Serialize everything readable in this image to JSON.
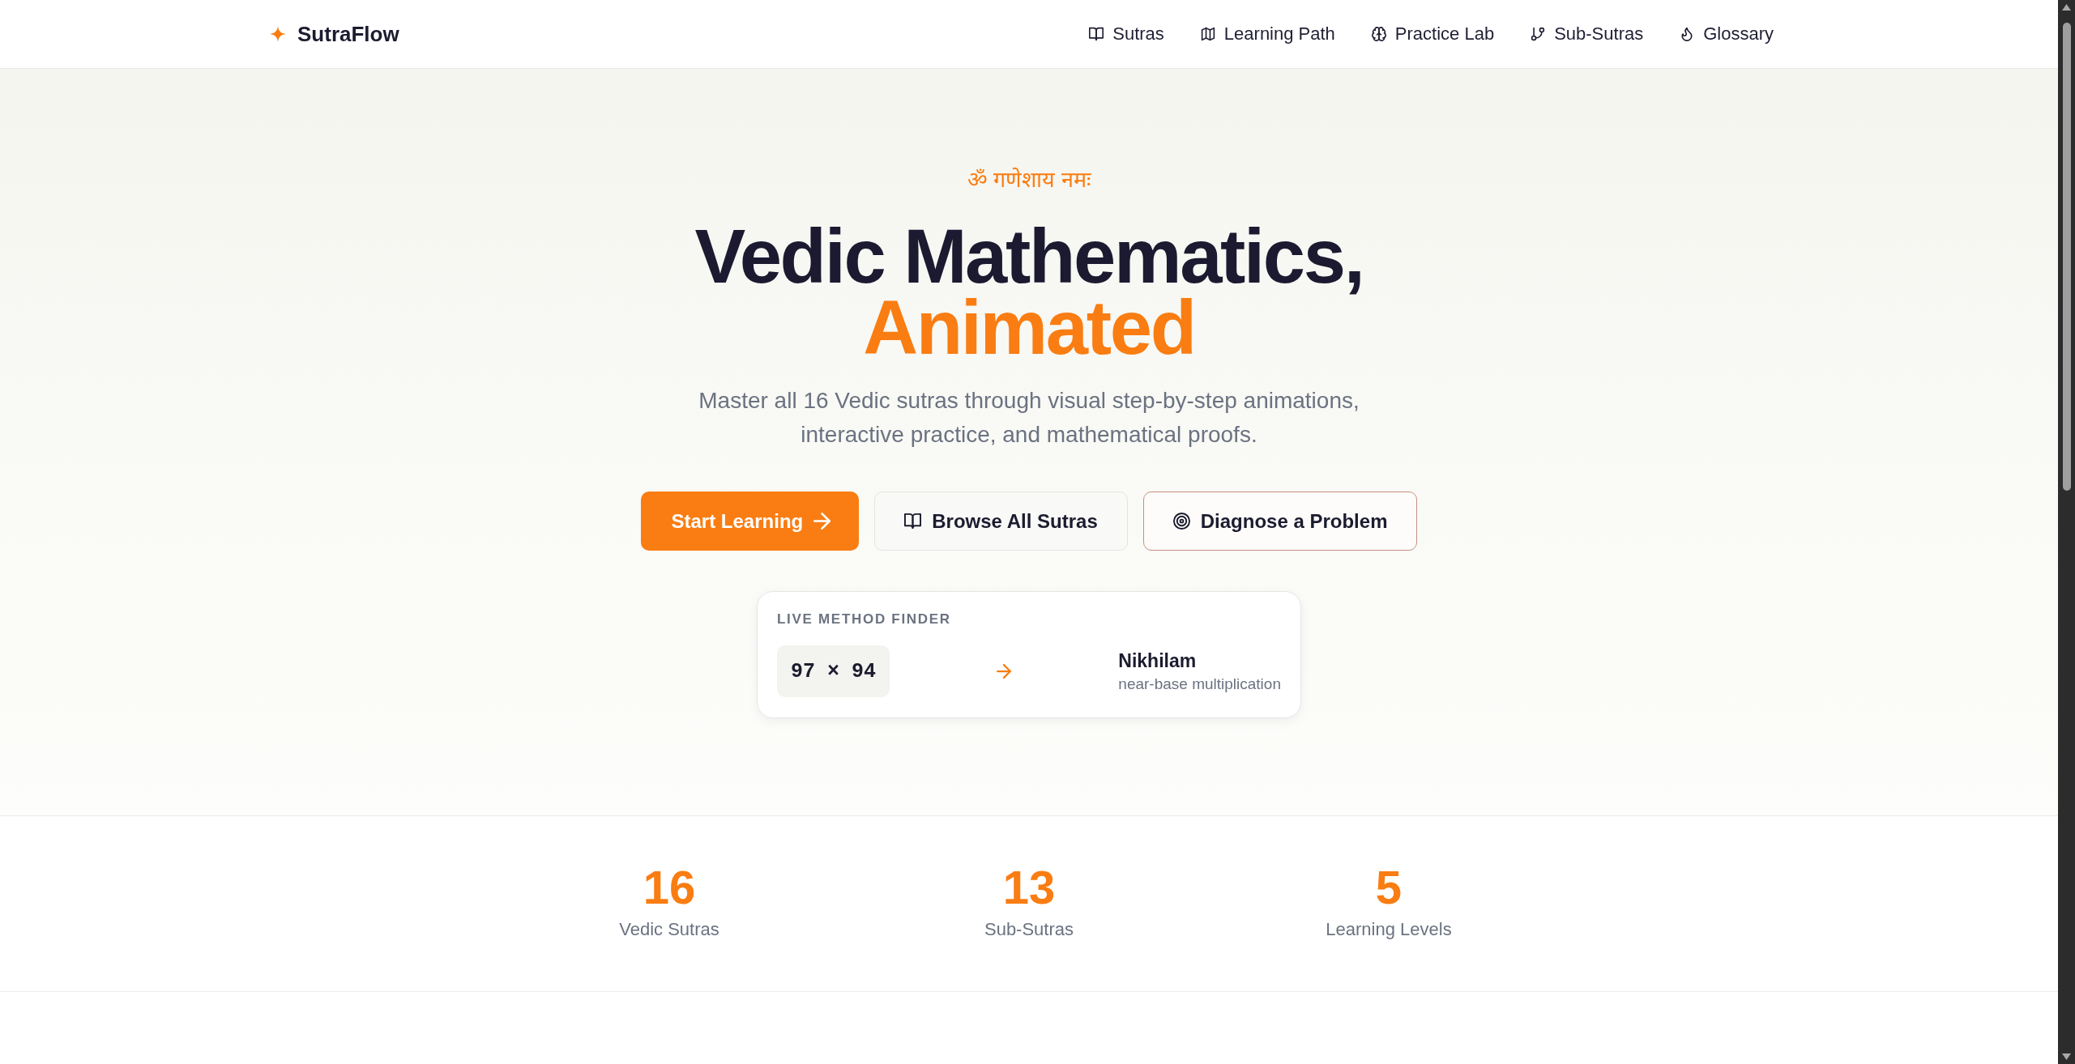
{
  "header": {
    "logo": "SutraFlow",
    "nav": [
      {
        "label": "Sutras"
      },
      {
        "label": "Learning Path"
      },
      {
        "label": "Practice Lab"
      },
      {
        "label": "Sub-Sutras"
      },
      {
        "label": "Glossary"
      }
    ]
  },
  "hero": {
    "invocation": "ॐ गणेशाय नमः",
    "title": "Vedic Mathematics,",
    "title_highlight": "Animated",
    "subtitle": "Master all 16 Vedic sutras through visual step-by-step animations, interactive practice, and mathematical proofs.",
    "buttons": [
      {
        "label": "Start Learning",
        "kind": "primary"
      },
      {
        "label": "Browse All Sutras",
        "kind": "secondary"
      },
      {
        "label": "Diagnose a Problem",
        "kind": "outline"
      }
    ],
    "method_finder": {
      "heading": "LIVE METHOD FINDER",
      "expression": "97 × 94",
      "method": "Nikhilam",
      "description": "near-base multiplication"
    }
  },
  "stats": [
    {
      "value": "16",
      "label": "Vedic Sutras"
    },
    {
      "value": "13",
      "label": "Sub-Sutras"
    },
    {
      "value": "5",
      "label": "Learning Levels"
    }
  ]
}
